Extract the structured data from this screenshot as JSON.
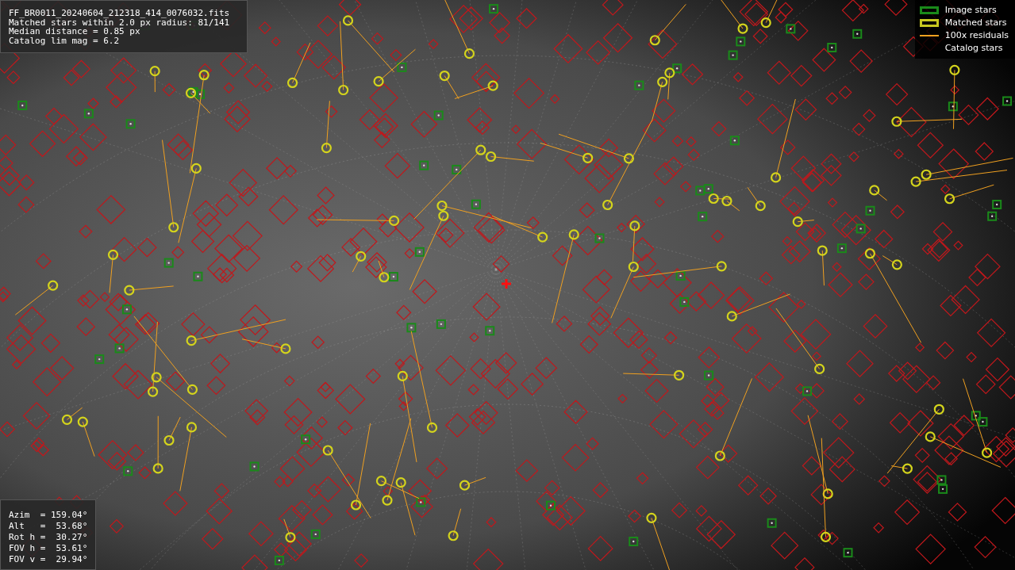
{
  "info_top": {
    "lines": [
      "FF_BR0011_20240604_212318_414_0076032.fits",
      "Matched stars within 2.0 px radius: 81/141",
      "Median distance = 0.85 px",
      "Catalog lim mag = 6.2"
    ]
  },
  "info_bottom": {
    "lines": [
      "Azim  = 159.04°",
      "Alt   =  53.68°",
      "Rot h =  30.27°",
      "FOV h =  53.61°",
      "FOV v =  29.94°"
    ]
  },
  "legend": [
    {
      "label": "Image stars",
      "kind": "box",
      "color": "#1a8a1a"
    },
    {
      "label": "Matched stars",
      "kind": "box",
      "color": "#c8c820"
    },
    {
      "label": "100x residuals",
      "kind": "line",
      "color": "#f0a020"
    },
    {
      "label": "Catalog stars",
      "kind": "none"
    }
  ]
}
